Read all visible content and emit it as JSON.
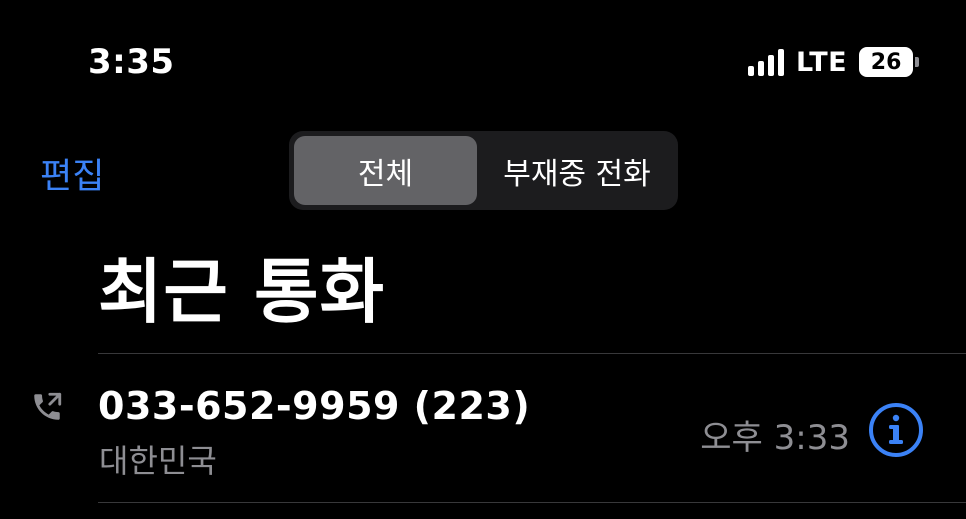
{
  "status_bar": {
    "time": "3:35",
    "network": "LTE",
    "battery_level": "26"
  },
  "nav": {
    "edit_label": "편집",
    "segments": [
      {
        "label": "전체",
        "selected": true
      },
      {
        "label": "부재중 전화",
        "selected": false
      }
    ]
  },
  "title": "최근 통화",
  "calls": [
    {
      "number": "033-652-9959 (223)",
      "region": "대한민국",
      "time": "오후 3:33",
      "type_icon": "outgoing-call-icon"
    }
  ],
  "colors": {
    "accent": "#3b82f6",
    "secondary_text": "#8e8e93",
    "background": "#000000",
    "selected_segment": "#636366"
  }
}
